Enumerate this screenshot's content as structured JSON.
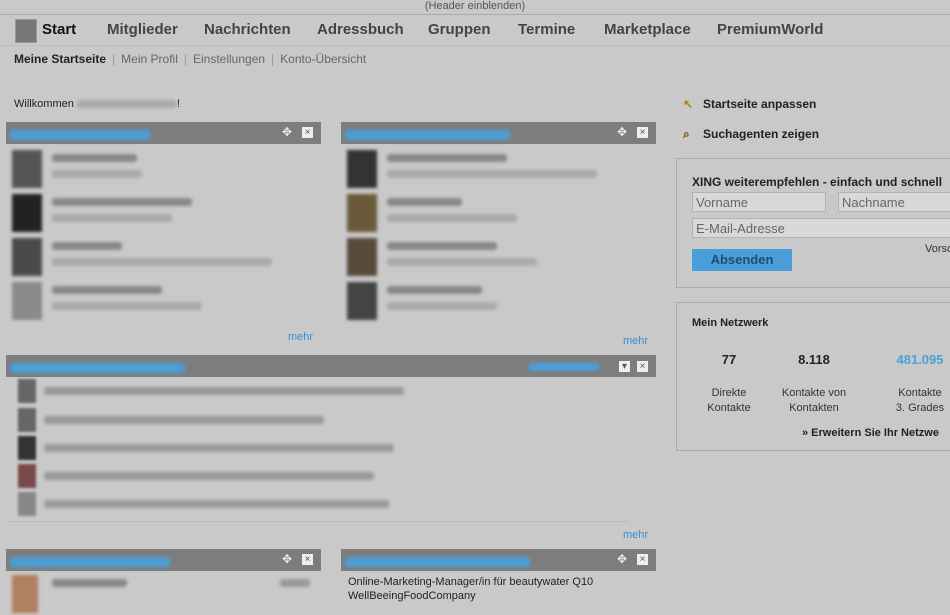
{
  "header_toggle": "(Header einblenden)",
  "nav": {
    "start": "Start",
    "items": [
      "Mitglieder",
      "Nachrichten",
      "Adressbuch",
      "Gruppen",
      "Termine",
      "Marketplace",
      "PremiumWorld"
    ]
  },
  "subnav": {
    "selected": "Meine Startseite",
    "items": [
      "Mein Profil",
      "Einstellungen",
      "Konto-Übersicht"
    ]
  },
  "welcome_prefix": "Willkommen",
  "welcome_suffix": "!",
  "panels": {
    "visitors": {
      "more": "mehr"
    },
    "contacts": {
      "more": "mehr"
    },
    "news": {
      "more": "mehr"
    },
    "birthdays": {},
    "jobs": {
      "items": [
        "Online-Marketing-Manager/in für beautywater Q10",
        "WellBeeingFoodCompany"
      ]
    }
  },
  "right": {
    "customize": "Startseite anpassen",
    "search_agents": "Suchagenten zeigen",
    "recommend": {
      "title": "XING weiterempfehlen - einfach und schnell",
      "firstname_placeholder": "Vorname",
      "lastname_placeholder": "Nachname",
      "email_placeholder": "E-Mail-Adresse",
      "preview": "Vorsc",
      "submit": "Absenden"
    },
    "network": {
      "title": "Mein Netzwerk",
      "direct_value": "77",
      "direct_label1": "Direkte",
      "direct_label2": "Kontakte",
      "second_value": "8.118",
      "second_label1": "Kontakte von",
      "second_label2": "Kontakten",
      "third_value": "481.095",
      "third_label1": "Kontakte",
      "third_label2": "3. Grades",
      "expand_link": "» Erweitern Sie Ihr Netzwe"
    }
  },
  "colors": {
    "accent": "#4b9fd9",
    "panel_header": "#7d7d7d",
    "background": "#c9c9c9"
  }
}
